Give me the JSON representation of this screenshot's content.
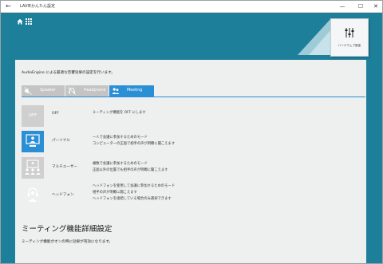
{
  "window": {
    "title": "LAVIEかんたん設定",
    "back_glyph": "←",
    "minimize_glyph": "—",
    "maximize_glyph": "☐",
    "close_glyph": "✕"
  },
  "header": {
    "hardware_button_label": "ハードウェア設定"
  },
  "main": {
    "intro": "AudioEngine による最適な音響効果の設定を行います。",
    "tabs": [
      {
        "label": "Speaker",
        "icon": "speaker-muted-icon"
      },
      {
        "label": "Headphone",
        "icon": "headphone-muted-icon"
      },
      {
        "label": "Meeting",
        "icon": "meeting-people-icon"
      }
    ],
    "selected_tab": "Meeting",
    "modes": [
      {
        "tile_text": "OFF",
        "name": "OFF",
        "desc": [
          "ミーティング機能を OFF にします"
        ],
        "selected": false
      },
      {
        "name": "パーソナル",
        "desc": [
          "一人で会議に参加するためのモード",
          "コンピューターの正面で相手の声が明瞭に聞こえます"
        ],
        "selected": true,
        "icon": "personal-monitor-icon"
      },
      {
        "name": "マルチユーザー",
        "desc": [
          "複数で会議に参加するためのモード",
          "正面以外の位置でも相手の声が明瞭に聞こえます"
        ],
        "selected": false,
        "icon": "multi-user-icon"
      },
      {
        "name": "ヘッドフォン",
        "desc": [
          "ヘッドフォンを使用して会議に参加するためのモード",
          "相手の声が明瞭に聞こえます",
          "ヘッドフォンを接続している場合のみ選択できます"
        ],
        "selected": false,
        "icon": "headphone-user-icon"
      }
    ]
  },
  "detail": {
    "title": "ミーティング機能詳細設定",
    "note": "ミーティング機能がオンの時に効果が有効になります。"
  },
  "colors": {
    "teal_background": "#1e7f9a",
    "accent_blue": "#2b8fd6",
    "inactive_gray": "#c4c4c4",
    "disabled_tile": "#cfcfcf"
  }
}
